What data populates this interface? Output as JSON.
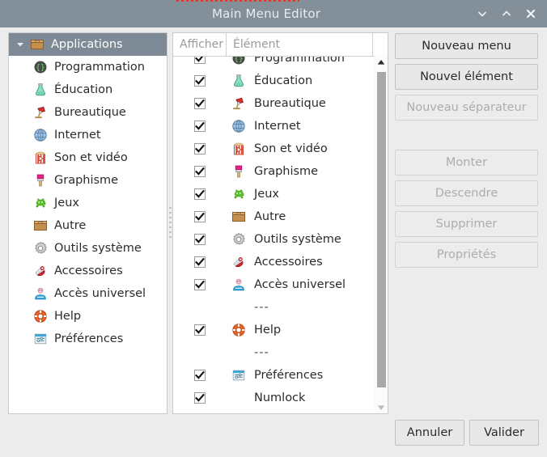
{
  "window": {
    "title": "Main Menu Editor",
    "controls": [
      {
        "name": "minimize",
        "glyph": "chevron-down"
      },
      {
        "name": "maximize",
        "glyph": "chevron-up"
      },
      {
        "name": "close",
        "glyph": "x"
      }
    ],
    "titlebar_color": "#838f99",
    "selection_color": "#7d8a95",
    "background_color": "#ececec"
  },
  "tree": {
    "root": {
      "label": "Applications",
      "icon": "box-icon",
      "expanded": true,
      "selected": true
    },
    "items": [
      {
        "label": "Programmation",
        "icon": "code-braces-icon"
      },
      {
        "label": "Éducation",
        "icon": "flask-icon"
      },
      {
        "label": "Bureautique",
        "icon": "desk-lamp-icon"
      },
      {
        "label": "Internet",
        "icon": "globe-icon"
      },
      {
        "label": "Son et vidéo",
        "icon": "media-popcorn-icon"
      },
      {
        "label": "Graphisme",
        "icon": "paintbrush-icon"
      },
      {
        "label": "Jeux",
        "icon": "alien-invader-icon"
      },
      {
        "label": "Autre",
        "icon": "box-icon"
      },
      {
        "label": "Outils système",
        "icon": "gear-icon"
      },
      {
        "label": "Accessoires",
        "icon": "swiss-knife-icon"
      },
      {
        "label": "Accès universel",
        "icon": "person-accessibility-icon"
      },
      {
        "label": "Help",
        "icon": "lifebuoy-icon"
      },
      {
        "label": "Préférences",
        "icon": "sliders-icon"
      }
    ]
  },
  "list": {
    "columns": {
      "show": "Afficher",
      "element": "Élément"
    },
    "rows": [
      {
        "label": "Programmation",
        "icon": "code-braces-icon",
        "checked": true,
        "separator": false
      },
      {
        "label": "Éducation",
        "icon": "flask-icon",
        "checked": true,
        "separator": false
      },
      {
        "label": "Bureautique",
        "icon": "desk-lamp-icon",
        "checked": true,
        "separator": false
      },
      {
        "label": "Internet",
        "icon": "globe-icon",
        "checked": true,
        "separator": false
      },
      {
        "label": "Son et vidéo",
        "icon": "media-popcorn-icon",
        "checked": true,
        "separator": false
      },
      {
        "label": "Graphisme",
        "icon": "paintbrush-icon",
        "checked": true,
        "separator": false
      },
      {
        "label": "Jeux",
        "icon": "alien-invader-icon",
        "checked": true,
        "separator": false
      },
      {
        "label": "Autre",
        "icon": "box-icon",
        "checked": true,
        "separator": false
      },
      {
        "label": "Outils système",
        "icon": "gear-icon",
        "checked": true,
        "separator": false
      },
      {
        "label": "Accessoires",
        "icon": "swiss-knife-icon",
        "checked": true,
        "separator": false
      },
      {
        "label": "Accès universel",
        "icon": "person-accessibility-icon",
        "checked": true,
        "separator": false
      },
      {
        "label": "---",
        "icon": null,
        "checked": false,
        "separator": true
      },
      {
        "label": "Help",
        "icon": "lifebuoy-icon",
        "checked": true,
        "separator": false
      },
      {
        "label": "---",
        "icon": null,
        "checked": false,
        "separator": true
      },
      {
        "label": "Préférences",
        "icon": "sliders-icon",
        "checked": true,
        "separator": false
      },
      {
        "label": "Numlock",
        "icon": null,
        "checked": true,
        "separator": false
      }
    ],
    "scrollbar": {
      "up_arrow": "▲",
      "down_arrow": "▼"
    }
  },
  "buttons": {
    "nouveau_menu": {
      "label": "Nouveau menu",
      "enabled": true
    },
    "nouvel_element": {
      "label": "Nouvel élément",
      "enabled": true
    },
    "nouveau_separateur": {
      "label": "Nouveau séparateur",
      "enabled": false
    },
    "monter": {
      "label": "Monter",
      "enabled": false
    },
    "descendre": {
      "label": "Descendre",
      "enabled": false
    },
    "supprimer": {
      "label": "Supprimer",
      "enabled": false
    },
    "proprietes": {
      "label": "Propriétés",
      "enabled": false
    },
    "annuler": {
      "label": "Annuler",
      "enabled": true
    },
    "valider": {
      "label": "Valider",
      "enabled": true
    }
  }
}
